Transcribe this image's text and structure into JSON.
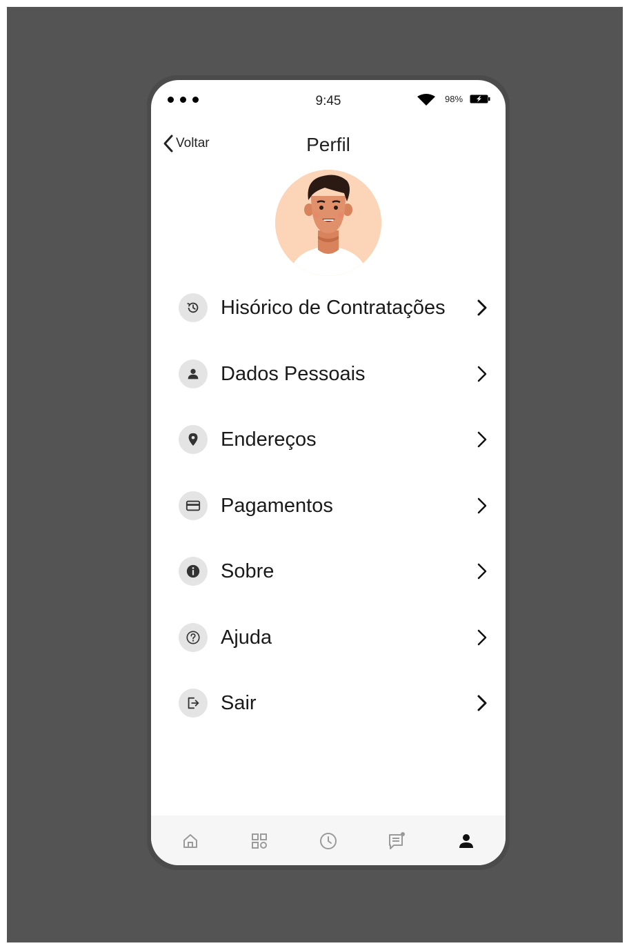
{
  "status_bar": {
    "time": "9:45",
    "battery": "98%",
    "signal_icon": "signal-dots-icon",
    "wifi_icon": "wifi-icon",
    "battery_icon": "battery-charging-icon"
  },
  "header": {
    "back_label": "Voltar",
    "title": "Perfil"
  },
  "avatar": {
    "icon": "user-avatar-illustration"
  },
  "menu": {
    "items": [
      {
        "label": "Hisórico de Contratações",
        "icon": "history-icon"
      },
      {
        "label": "Dados Pessoais",
        "icon": "person-icon"
      },
      {
        "label": "Endereços",
        "icon": "location-pin-icon"
      },
      {
        "label": "Pagamentos",
        "icon": "credit-card-icon"
      },
      {
        "label": "Sobre",
        "icon": "info-icon"
      },
      {
        "label": "Ajuda",
        "icon": "help-icon"
      },
      {
        "label": "Sair",
        "icon": "logout-icon"
      }
    ]
  },
  "tab_bar": {
    "tabs": [
      {
        "name": "home",
        "icon": "home-icon",
        "active": false
      },
      {
        "name": "categories",
        "icon": "grid-icon",
        "active": false
      },
      {
        "name": "history",
        "icon": "clock-icon",
        "active": false
      },
      {
        "name": "messages",
        "icon": "chat-icon",
        "active": false
      },
      {
        "name": "profile",
        "icon": "profile-icon",
        "active": true
      }
    ]
  },
  "colors": {
    "background": "#545454",
    "screen": "#ffffff",
    "icon_circle": "#e4e4e4",
    "text": "#1a1a1a",
    "tab_bar": "#f6f6f6",
    "tab_inactive": "#9a9a9a",
    "tab_active": "#111111",
    "avatar_bg": "#fcd5b8"
  }
}
